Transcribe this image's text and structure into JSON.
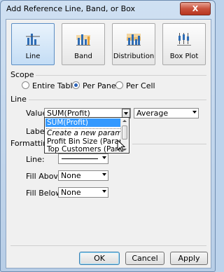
{
  "window": {
    "title": "Add Reference Line, Band, or Box",
    "close_glyph": "X"
  },
  "types": [
    {
      "label": "Line",
      "icon": "line-chart-icon",
      "selected": true
    },
    {
      "label": "Band",
      "icon": "band-chart-icon",
      "selected": false
    },
    {
      "label": "Distribution",
      "icon": "distribution-chart-icon",
      "selected": false
    },
    {
      "label": "Box Plot",
      "icon": "box-plot-icon",
      "selected": false
    }
  ],
  "scope": {
    "header": "Scope",
    "options": [
      {
        "label": "Entire Table",
        "selected": false
      },
      {
        "label": "Per Pane",
        "selected": true
      },
      {
        "label": "Per Cell",
        "selected": false
      }
    ]
  },
  "line": {
    "header": "Line",
    "value_label": "Value:",
    "value_selected": "SUM(Profit)",
    "aggregation": "Average",
    "label_label": "Label:"
  },
  "dropdown": {
    "items": [
      {
        "text": "SUM(Profit)",
        "highlighted": true
      },
      {
        "text": "Create a new parameter...",
        "italic": true
      },
      {
        "text": "Profit Bin Size (Parameters)"
      },
      {
        "text": "Top Customers (Parameters)"
      }
    ]
  },
  "formatting": {
    "header": "Formatting",
    "line_label": "Line:",
    "fill_above_label": "Fill Above:",
    "fill_above_value": "None",
    "fill_below_label": "Fill Below:",
    "fill_below_value": "None"
  },
  "buttons": {
    "ok": "OK",
    "cancel": "Cancel",
    "apply": "Apply"
  },
  "colors": {
    "accent": "#3399ff",
    "selected_type_bg": "#c4ddf5",
    "icon_blue": "#2f6db5",
    "icon_orange": "#e6a33c"
  }
}
